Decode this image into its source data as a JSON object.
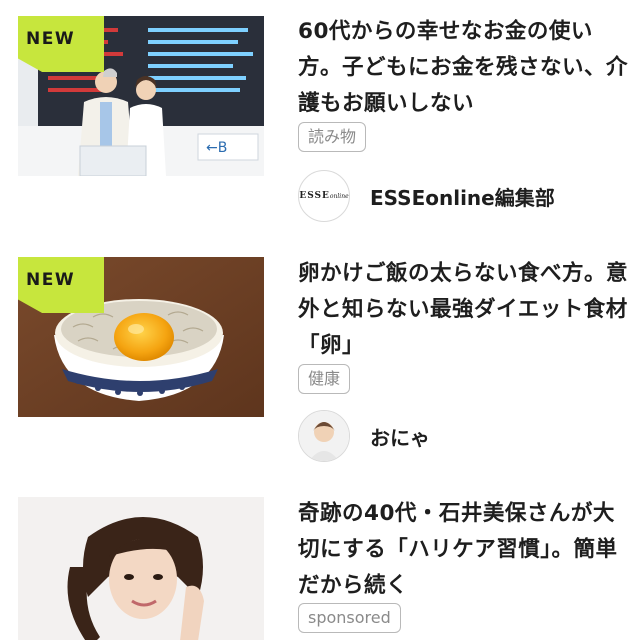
{
  "articles": [
    {
      "badge": "NEW",
      "image_alt": "senior-couple-airport-photo",
      "title": "60代からの幸せなお金の使い方。子どもにお金を残さない、介護もお願いしない",
      "tag": "読み物",
      "author": {
        "name": "ESSEonline編集部",
        "avatar_text": "ESSE",
        "avatar_sub": "online"
      }
    },
    {
      "badge": "NEW",
      "image_alt": "egg-over-rice-bowl-photo",
      "title": "卵かけご飯の太らない食べ方。意外と知らない最強ダイエット食材「卵」",
      "tag": "健康",
      "author": {
        "name": "おにゃ",
        "avatar_text": ""
      }
    },
    {
      "badge": "",
      "image_alt": "woman-portrait-photo",
      "title": "奇跡の40代・石井美保さんが大切にする「ハリケア習慣」。簡単だから続く",
      "tag": "sponsored",
      "author": null
    }
  ]
}
